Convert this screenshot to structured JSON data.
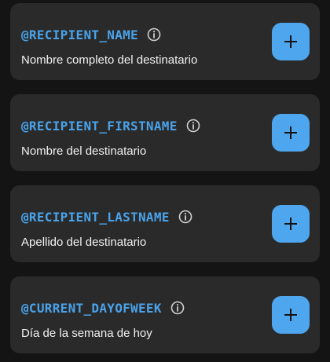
{
  "colors": {
    "background": "#141414",
    "card": "#2a2a2b",
    "accent": "#4aa3ea",
    "button": "#4ea6ee",
    "text": "#f2f2f2",
    "icon": "#cfcfcf"
  },
  "icons": {
    "info": "info-icon",
    "add": "plus-icon"
  },
  "variables": [
    {
      "name": "@RECIPIENT_NAME",
      "description": "Nombre completo del destinatario"
    },
    {
      "name": "@RECIPIENT_FIRSTNAME",
      "description": "Nombre del destinatario"
    },
    {
      "name": "@RECIPIENT_LASTNAME",
      "description": "Apellido del destinatario"
    },
    {
      "name": "@CURRENT_DAYOFWEEK",
      "description": "Día de la semana de hoy"
    }
  ]
}
